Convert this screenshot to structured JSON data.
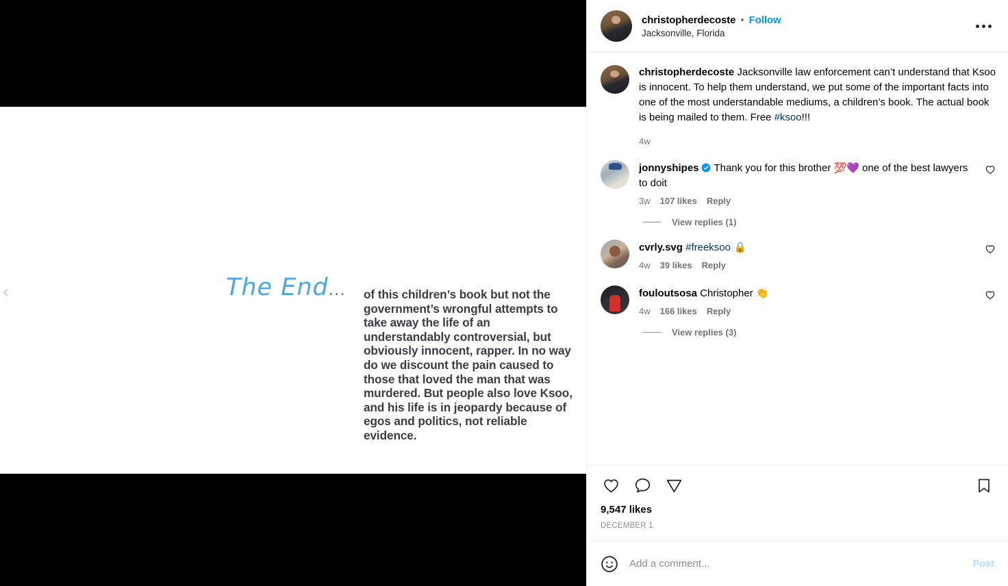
{
  "media": {
    "alt_name": "carousel-image",
    "prev_button_label": "Previous",
    "slide": {
      "headline": "The End",
      "headline_dots": "...",
      "body": "of this children’s book but not the government’s wrongful attempts to take away the life of an understandably controversial, but obviously innocent, rapper. In no way do we discount the pain caused to those that loved the man that was murdered. But people also love Ksoo, and his life is in jeopardy because of egos and politics, not reliable evidence.",
      "headline_color": "#4aa8de",
      "body_color": "#3c3c44"
    }
  },
  "header": {
    "username": "christopherdecoste",
    "separator": "•",
    "follow_label": "Follow",
    "location": "Jacksonville, Florida",
    "menu_icon": "more-options-icon"
  },
  "caption": {
    "username": "christopherdecoste",
    "text": "Jacksonville law enforcement can’t understand that Ksoo is innocent. To help them understand, we put some of the important facts into one of the most understandable mediums, a children’s book. The actual book is being mailed to them. Free ",
    "hashtag": "#ksoo",
    "text_after_hashtag": "!!!",
    "timestamp": "4w"
  },
  "comments": [
    {
      "username": "jonnyshipes",
      "verified": true,
      "text_before_emoji": "Thank you for this brother ",
      "emoji": "💯💜",
      "text_after_emoji": " one of the best lawyers to doit",
      "timestamp": "3w",
      "likes": "107 likes",
      "reply_label": "Reply",
      "view_replies": "View replies (1)",
      "like_icon": "heart-outline-icon"
    },
    {
      "username": "cvrly.svg",
      "verified": false,
      "text_before_emoji": "",
      "hashtag": "#freeksoo",
      "emoji": " 🔒",
      "text_after_emoji": "",
      "timestamp": "4w",
      "likes": "39 likes",
      "reply_label": "Reply",
      "view_replies": null,
      "like_icon": "heart-outline-icon"
    },
    {
      "username": "fouloutsosa",
      "verified": false,
      "text_before_emoji": "Christopher ",
      "emoji": "👏",
      "text_after_emoji": "",
      "timestamp": "4w",
      "likes": "166 likes",
      "reply_label": "Reply",
      "view_replies": "View replies (3)",
      "like_icon": "heart-outline-icon"
    }
  ],
  "actions": {
    "like_icon": "heart-outline-icon",
    "comment_icon": "comment-bubble-icon",
    "share_icon": "share-paper-plane-icon",
    "save_icon": "bookmark-outline-icon",
    "likes_count": "9,547 likes",
    "post_date": "DECEMBER 1"
  },
  "composer": {
    "emoji_icon": "emoji-smiley-icon",
    "placeholder": "Add a comment...",
    "value": "",
    "post_label": "Post",
    "post_color": "#b2dffc"
  },
  "colors": {
    "accent_blue": "#0095f6",
    "link_navy": "#00376b",
    "muted_grey": "#737373",
    "divider": "#efefef"
  }
}
